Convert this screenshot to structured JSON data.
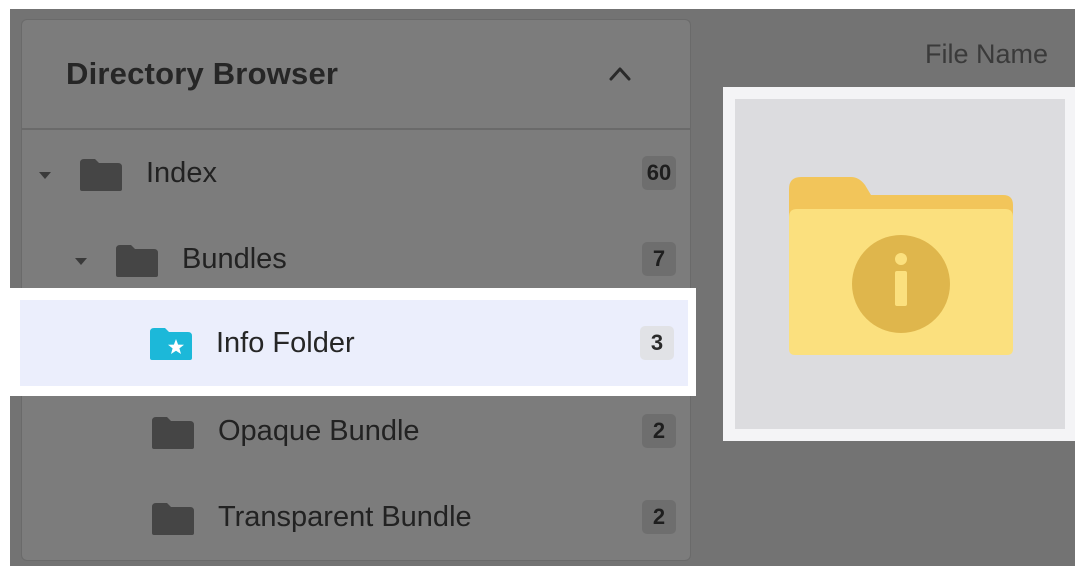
{
  "sidebar": {
    "title": "Directory Browser",
    "collapse_icon": "chevron-up-icon",
    "items": [
      {
        "label": "Index",
        "count": "60",
        "icon": "folder-icon",
        "expanded": true,
        "selected": false
      },
      {
        "label": "Bundles",
        "count": "7",
        "icon": "folder-icon",
        "expanded": true,
        "selected": false
      },
      {
        "label": "Info Folder",
        "count": "3",
        "icon": "star-folder-icon",
        "selected": true
      },
      {
        "label": "Opaque Bundle",
        "count": "2",
        "icon": "folder-icon",
        "selected": false
      },
      {
        "label": "Transparent Bundle",
        "count": "2",
        "icon": "folder-icon",
        "selected": false
      }
    ]
  },
  "main": {
    "column_header": "File Name",
    "preview_icon": "info-folder-icon"
  },
  "colors": {
    "dim_overlay": "#737373",
    "selected_row_bg": "#ebeefc",
    "star_folder": "#1cb8d9",
    "preview_folder": "#fbe07e",
    "preview_info_circle": "#dfb64c"
  }
}
